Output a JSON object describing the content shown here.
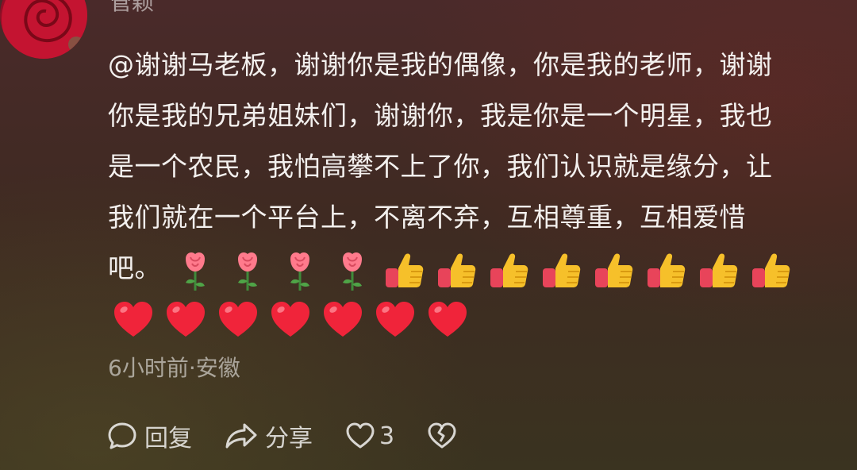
{
  "comment": {
    "author": "管颖",
    "lines": [
      "@谢谢马老板，谢谢你是我的偶像，你是我的老师，谢谢",
      "你是我的兄弟姐妹们，谢谢你，我是你是一个明星，我也",
      "是一个农民，我怕高攀不上了你，我们认识就是缘分，让",
      "我们就在一个平台上，不离不弃，互相尊重，互相爱惜",
      "吧。"
    ],
    "emoji_row1": [
      "rose-emoji",
      "rose-emoji",
      "rose-emoji",
      "rose-emoji",
      "thumbs-up-emoji",
      "thumbs-up-emoji",
      "thumbs-up-emoji",
      "thumbs-up-emoji",
      "thumbs-up-emoji",
      "thumbs-up-emoji",
      "thumbs-up-emoji",
      "thumbs-up-emoji"
    ],
    "emoji_row2": [
      "heart-emoji",
      "heart-emoji",
      "heart-emoji",
      "heart-emoji",
      "heart-emoji",
      "heart-emoji",
      "heart-emoji"
    ],
    "time_location": "6小时前·安徽"
  },
  "actions": {
    "reply_label": "回复",
    "share_label": "分享",
    "like_count": "3",
    "reply_icon": "chat-bubble-icon",
    "share_icon": "share-arrow-icon",
    "like_icon": "heart-outline-icon",
    "dislike_icon": "broken-heart-icon"
  },
  "colors": {
    "heart": "#f0243a",
    "thumb": "#f6c02a",
    "sleeve": "#e8445a",
    "rose": "#ff7a8c"
  }
}
